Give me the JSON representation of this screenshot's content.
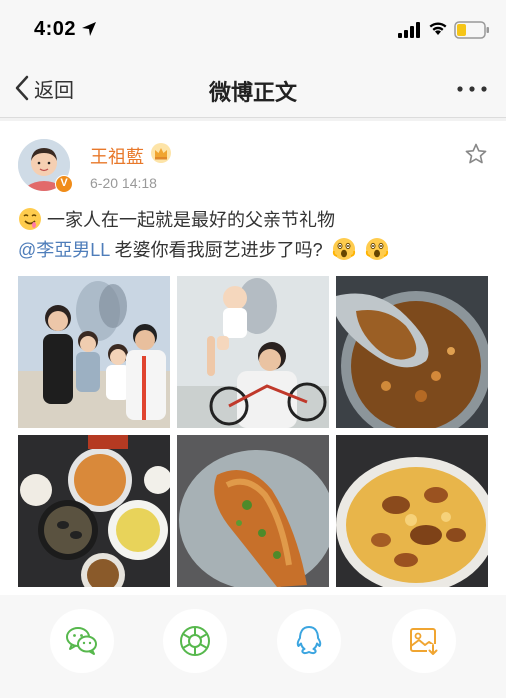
{
  "status_bar": {
    "time": "4:02"
  },
  "nav": {
    "back_label": "返回",
    "title": "微博正文"
  },
  "post": {
    "user_name": "王祖藍",
    "verified_badge": "V",
    "time": "6-20 14:18",
    "text_line1": "一家人在一起就是最好的父亲节礼物",
    "mention": "@李亞男LL",
    "text_line2": " 老婆你看我厨艺进步了吗?",
    "images": [
      "family-photo-1",
      "family-photo-2",
      "curry-dish-photo",
      "dinner-table-photo",
      "grilled-fish-photo",
      "baked-cheese-rice-photo"
    ]
  },
  "share_bar": {
    "items": [
      "wechat-icon",
      "moments-icon",
      "qq-icon",
      "save-image-icon"
    ]
  },
  "colors": {
    "user_name": "#e8782a",
    "mention": "#4e7dba",
    "wechat": "#57b84d",
    "moments": "#57b84d",
    "qq": "#3ba5e0",
    "save": "#f0a531",
    "badge": "#f08c19"
  }
}
